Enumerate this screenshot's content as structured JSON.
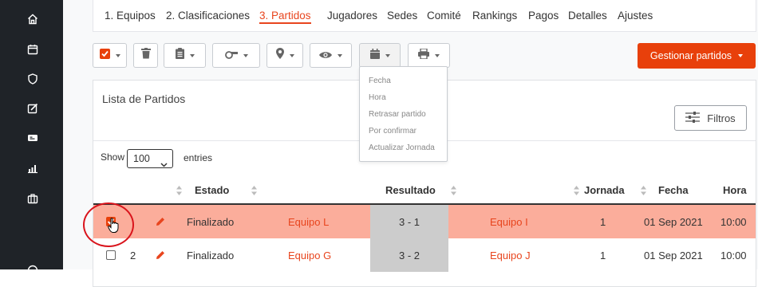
{
  "sidebar": {
    "icons": [
      "home-icon",
      "calendar-icon",
      "shield-icon",
      "edit-icon",
      "ticket-icon",
      "bar-chart-icon",
      "briefcase-icon",
      "help-icon"
    ]
  },
  "tabs": [
    {
      "label": "1. Equipos",
      "active": false
    },
    {
      "label": "2. Clasificaciones",
      "active": false
    },
    {
      "label": "3. Partidos",
      "active": true
    },
    {
      "label": "Jugadores",
      "active": false
    },
    {
      "label": "Sedes",
      "active": false
    },
    {
      "label": "Comité",
      "active": false
    },
    {
      "label": "Rankings",
      "active": false
    },
    {
      "label": "Pagos",
      "active": false
    },
    {
      "label": "Detalles",
      "active": false
    },
    {
      "label": "Ajustes",
      "active": false
    }
  ],
  "toolbar": {
    "tools": [
      "select-checkbox-icon",
      "trash-icon",
      "clipboard-icon",
      "whistle-icon",
      "map-pin-icon",
      "eye-icon",
      "calendar-icon",
      "print-icon"
    ],
    "manage_label": "Gestionar partidos"
  },
  "dropdown": {
    "items": [
      "Fecha",
      "Hora",
      "Retrasar partido",
      "Por confirmar",
      "Actualizar Jornada"
    ]
  },
  "panel": {
    "title": "Lista de Partidos",
    "filters_label": "Filtros",
    "show_label": "Show",
    "entries_value": "100",
    "entries_label": "entries"
  },
  "table": {
    "columns": {
      "estado": "Estado",
      "resultado": "Resultado",
      "jornada": "Jornada",
      "fecha": "Fecha",
      "hora": "Hora"
    },
    "rows": [
      {
        "num": "",
        "estado": "Finalizado",
        "home": "Equipo L",
        "score": "3 - 1",
        "away": "Equipo I",
        "jornada": "1",
        "fecha": "01 Sep 2021",
        "hora": "10:00",
        "selected": true
      },
      {
        "num": "2",
        "estado": "Finalizado",
        "home": "Equipo G",
        "score": "3 - 2",
        "away": "Equipo J",
        "jornada": "1",
        "fecha": "01 Sep 2021",
        "hora": "10:00",
        "selected": false
      }
    ]
  },
  "colors": {
    "accent": "#e8451e",
    "selected_row": "#fbad9b",
    "score_bg": "#cccccc",
    "sidebar_bg": "#1f2328"
  }
}
